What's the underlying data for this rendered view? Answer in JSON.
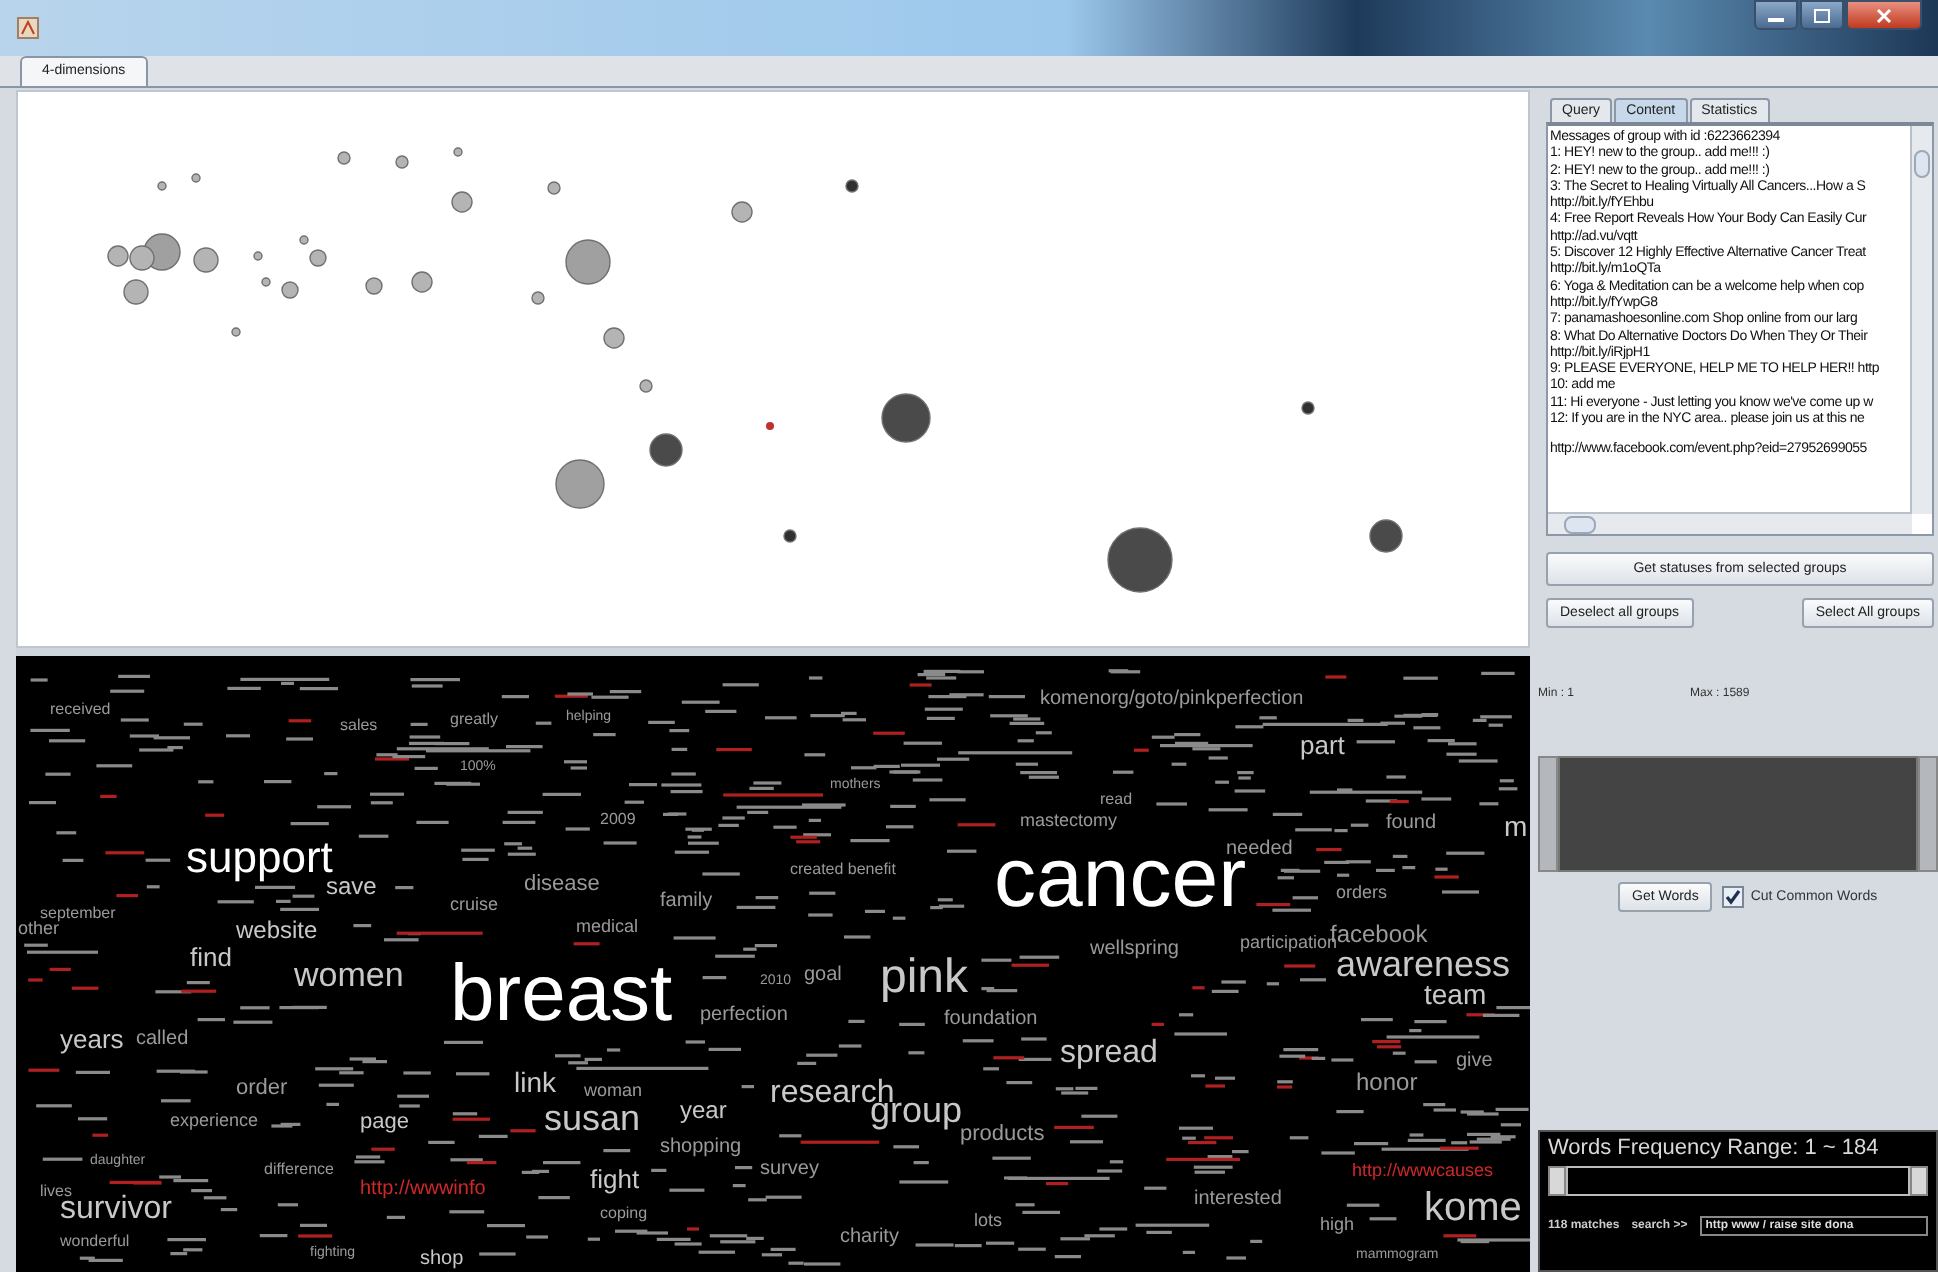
{
  "tabs": [
    {
      "label": "4-dimensions",
      "selected": true
    }
  ],
  "word_cloud": {
    "words": [
      {
        "text": "received",
        "color": "#9a9a9a"
      },
      {
        "text": "sales",
        "color": "#9a9a9a"
      },
      {
        "text": "greatly",
        "color": "#9a9a9a"
      },
      {
        "text": "helping",
        "color": "#9a9a9a"
      },
      {
        "text": "100%",
        "color": "#9a9a9a"
      },
      {
        "text": "2009",
        "color": "#9a9a9a"
      },
      {
        "text": "support",
        "color": "#ffffff"
      },
      {
        "text": "save",
        "color": "#c8c8c8"
      },
      {
        "text": "disease",
        "color": "#9a9a9a"
      },
      {
        "text": "cruise",
        "color": "#9a9a9a"
      },
      {
        "text": "family",
        "color": "#9a9a9a"
      },
      {
        "text": "september",
        "color": "#9a9a9a"
      },
      {
        "text": "other",
        "color": "#9a9a9a"
      },
      {
        "text": "website",
        "color": "#c8c8c8"
      },
      {
        "text": "medical",
        "color": "#9a9a9a"
      },
      {
        "text": "find",
        "color": "#c8c8c8"
      },
      {
        "text": "women",
        "color": "#c8c8c8"
      },
      {
        "text": "breast",
        "color": "#ffffff"
      },
      {
        "text": "years",
        "color": "#c8c8c8"
      },
      {
        "text": "called",
        "color": "#9a9a9a"
      },
      {
        "text": "order",
        "color": "#9a9a9a"
      },
      {
        "text": "link",
        "color": "#c8c8c8"
      },
      {
        "text": "woman",
        "color": "#9a9a9a"
      },
      {
        "text": "experience",
        "color": "#9a9a9a"
      },
      {
        "text": "page",
        "color": "#c8c8c8"
      },
      {
        "text": "susan",
        "color": "#c8c8c8"
      },
      {
        "text": "shopping",
        "color": "#9a9a9a"
      },
      {
        "text": "daughter",
        "color": "#9a9a9a"
      },
      {
        "text": "lives",
        "color": "#9a9a9a"
      },
      {
        "text": "survivor",
        "color": "#c8c8c8"
      },
      {
        "text": "difference",
        "color": "#9a9a9a"
      },
      {
        "text": "http://wwwinfo",
        "color": "#d02828"
      },
      {
        "text": "fight",
        "color": "#c8c8c8"
      },
      {
        "text": "coping",
        "color": "#9a9a9a"
      },
      {
        "text": "wonderful",
        "color": "#9a9a9a"
      },
      {
        "text": "fighting",
        "color": "#9a9a9a"
      },
      {
        "text": "shop",
        "color": "#c8c8c8"
      },
      {
        "text": "komenorg/goto/pinkperfection",
        "color": "#9a9a9a"
      },
      {
        "text": "part",
        "color": "#c8c8c8"
      },
      {
        "text": "mothers",
        "color": "#9a9a9a"
      },
      {
        "text": "read",
        "color": "#9a9a9a"
      },
      {
        "text": "mastectomy",
        "color": "#9a9a9a"
      },
      {
        "text": "found",
        "color": "#9a9a9a"
      },
      {
        "text": "m",
        "color": "#c8c8c8"
      },
      {
        "text": "created benefit",
        "color": "#9a9a9a"
      },
      {
        "text": "cancer",
        "color": "#ffffff"
      },
      {
        "text": "needed",
        "color": "#9a9a9a"
      },
      {
        "text": "orders",
        "color": "#9a9a9a"
      },
      {
        "text": "facebook",
        "color": "#9a9a9a"
      },
      {
        "text": "wellspring",
        "color": "#9a9a9a"
      },
      {
        "text": "participation",
        "color": "#9a9a9a"
      },
      {
        "text": "awareness",
        "color": "#c8c8c8"
      },
      {
        "text": "2010",
        "color": "#9a9a9a"
      },
      {
        "text": "goal",
        "color": "#9a9a9a"
      },
      {
        "text": "pink",
        "color": "#c8c8c8"
      },
      {
        "text": "team",
        "color": "#c8c8c8"
      },
      {
        "text": "perfection",
        "color": "#9a9a9a"
      },
      {
        "text": "foundation",
        "color": "#9a9a9a"
      },
      {
        "text": "spread",
        "color": "#c8c8c8"
      },
      {
        "text": "give",
        "color": "#9a9a9a"
      },
      {
        "text": "year",
        "color": "#c8c8c8"
      },
      {
        "text": "research",
        "color": "#c8c8c8"
      },
      {
        "text": "group",
        "color": "#c8c8c8"
      },
      {
        "text": "honor",
        "color": "#9a9a9a"
      },
      {
        "text": "products",
        "color": "#9a9a9a"
      },
      {
        "text": "survey",
        "color": "#9a9a9a"
      },
      {
        "text": "http://wwwcauses",
        "color": "#d02828"
      },
      {
        "text": "interested",
        "color": "#9a9a9a"
      },
      {
        "text": "lots",
        "color": "#9a9a9a"
      },
      {
        "text": "kome",
        "color": "#c8c8c8"
      },
      {
        "text": "high",
        "color": "#9a9a9a"
      },
      {
        "text": "charity",
        "color": "#9a9a9a"
      },
      {
        "text": "mammogram",
        "color": "#9a9a9a"
      }
    ]
  },
  "side_panel": {
    "tabs": [
      {
        "label": "Query",
        "selected": false
      },
      {
        "label": "Content",
        "selected": true
      },
      {
        "label": "Statistics",
        "selected": false
      }
    ],
    "messages": [
      "Messages of group with id :6223662394",
      "1: HEY! new to the group.. add me!!! :)",
      "2: HEY! new to the group.. add me!!! :)",
      "3: The Secret to Healing Virtually All Cancers...How a S",
      "http://bit.ly/fYEhbu",
      "4: Free Report Reveals How Your Body Can Easily Cur",
      "http://ad.vu/vqtt",
      "5: Discover 12 Highly Effective Alternative Cancer Treat",
      "http://bit.ly/m1oQTa",
      "6: Yoga & Meditation can be a welcome help when cop",
      "http://bit.ly/fYwpG8",
      "7: panamashoesonline.com  Shop online from our larg",
      "8: What Do Alternative Doctors Do When They Or Their",
      "http://bit.ly/iRjpH1",
      "9: PLEASE EVERYONE, HELP ME TO HELP HER!! http",
      "10: add me",
      "11: Hi everyone - Just letting you know we've come up w",
      "12: If you are in the NYC area.. please join us at this ne",
      "http://www.facebook.com/event.php?eid=27952699055"
    ],
    "get_statuses_button": "Get statuses from selected groups",
    "deselect_button": "Deselect all groups",
    "select_button": "Select All groups",
    "min_label": "Min : 1",
    "max_label": "Max : 1589",
    "get_words_button": "Get Words",
    "cut_common_words": {
      "label": "Cut Common Words",
      "checked": true
    }
  },
  "frequency_panel": {
    "title": "Words Frequency Range: 1 ~ 184",
    "level": 1,
    "matches": "118 matches",
    "search_label": "search >>",
    "search_value": "http www / raise site dona"
  }
}
